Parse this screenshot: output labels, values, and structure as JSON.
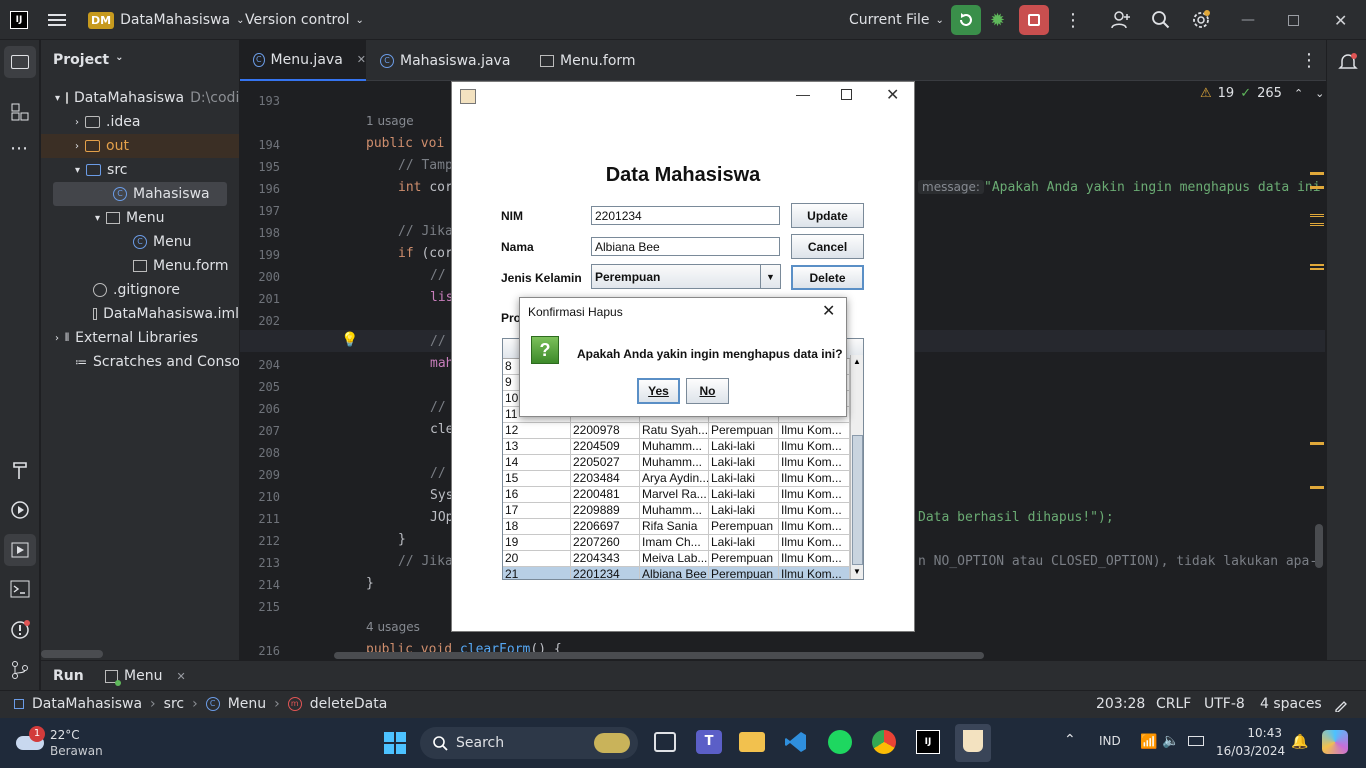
{
  "titlebar": {
    "app_badge": "DM",
    "project_name": "DataMahasiswa",
    "vcs": "Version control",
    "run_config": "Current File"
  },
  "project_panel": {
    "title": "Project",
    "root": "DataMahasiswa",
    "root_path": "D:\\codi",
    "items": [
      {
        "label": ".idea"
      },
      {
        "label": "out"
      },
      {
        "label": "src"
      },
      {
        "label": "Mahasiswa"
      },
      {
        "label": "Menu"
      },
      {
        "label": "Menu"
      },
      {
        "label": "Menu.form"
      },
      {
        "label": ".gitignore"
      },
      {
        "label": "DataMahasiswa.iml"
      },
      {
        "label": "External Libraries"
      },
      {
        "label": "Scratches and Consoles"
      }
    ]
  },
  "tabs": [
    {
      "label": "Menu.java"
    },
    {
      "label": "Mahasiswa.java"
    },
    {
      "label": "Menu.form"
    }
  ],
  "inspections": {
    "warnings": "19",
    "ok": "265"
  },
  "editor": {
    "usage1": "1 usage",
    "usage2": "4 usages",
    "lines": [
      "193",
      "194",
      "195",
      "196",
      "197",
      "198",
      "199",
      "200",
      "201",
      "202",
      "203",
      "204",
      "205",
      "206",
      "207",
      "208",
      "209",
      "210",
      "211",
      "212",
      "213",
      "214",
      "215",
      "216"
    ],
    "code": {
      "l194a": "public ",
      "l194b": "voi",
      "l195": "// Tamp",
      "l196a": "int ",
      "l196b": "cor",
      "l196hint": "message:",
      "l196str": "\"Apakah Anda yakin ingin menghapus data ini",
      "l198": "// Jika",
      "l199a": "if ",
      "l199b": "(cor",
      "l200": "//",
      "l201": "lis",
      "l203": "//",
      "l204": "mah",
      "l206": "//",
      "l207": "cle",
      "l209": "//",
      "l210": "Sys",
      "l211a": "JOp",
      "l211b": "Data berhasil dihapus!\");",
      "l212": "}",
      "l213a": "// Jika",
      "l213b": "n NO_OPTION atau CLOSED_OPTION), tidak lakukan apa-",
      "l214": "}",
      "l216a": "public void ",
      "l216b": "clearForm",
      "l216c": "() {"
    }
  },
  "swing": {
    "heading": "Data Mahasiswa",
    "nim_label": "NIM",
    "nim_value": "2201234",
    "nama_label": "Nama",
    "nama_value": "Albiana Bee",
    "jk_label": "Jenis Kelamin",
    "jk_value": "Perempuan",
    "update_label": "Update",
    "cancel_label": "Cancel",
    "delete_label": "Delete",
    "prodi_label": "Pro",
    "rows": [
      {
        "no": "8",
        "nim": "",
        "nama": "",
        "jk": "",
        "prodi": ""
      },
      {
        "no": "9",
        "nim": "",
        "nama": "",
        "jk": "",
        "prodi": ""
      },
      {
        "no": "10",
        "nim": "",
        "nama": "",
        "jk": "",
        "prodi": ""
      },
      {
        "no": "11",
        "nim": "",
        "nama": "",
        "jk": "",
        "prodi": ""
      },
      {
        "no": "12",
        "nim": "2200978",
        "nama": "Ratu Syah...",
        "jk": "Perempuan",
        "prodi": "Ilmu Kom..."
      },
      {
        "no": "13",
        "nim": "2204509",
        "nama": "Muhamm...",
        "jk": "Laki-laki",
        "prodi": "Ilmu Kom..."
      },
      {
        "no": "14",
        "nim": "2205027",
        "nama": "Muhamm...",
        "jk": "Laki-laki",
        "prodi": "Ilmu Kom..."
      },
      {
        "no": "15",
        "nim": "2203484",
        "nama": "Arya Aydin...",
        "jk": "Laki-laki",
        "prodi": "Ilmu Kom..."
      },
      {
        "no": "16",
        "nim": "2200481",
        "nama": "Marvel Ra...",
        "jk": "Laki-laki",
        "prodi": "Ilmu Kom..."
      },
      {
        "no": "17",
        "nim": "2209889",
        "nama": "Muhamm...",
        "jk": "Laki-laki",
        "prodi": "Ilmu Kom..."
      },
      {
        "no": "18",
        "nim": "2206697",
        "nama": "Rifa Sania",
        "jk": "Perempuan",
        "prodi": "Ilmu Kom..."
      },
      {
        "no": "19",
        "nim": "2207260",
        "nama": "Imam Ch...",
        "jk": "Laki-laki",
        "prodi": "Ilmu Kom..."
      },
      {
        "no": "20",
        "nim": "2204343",
        "nama": "Meiva Lab...",
        "jk": "Perempuan",
        "prodi": "Ilmu Kom..."
      },
      {
        "no": "21",
        "nim": "2201234",
        "nama": "Albiana Bee",
        "jk": "Perempuan",
        "prodi": "Ilmu Kom..."
      }
    ]
  },
  "dialog": {
    "title": "Konfirmasi Hapus",
    "message": "Apakah Anda yakin ingin menghapus data ini?",
    "yes": "Yes",
    "no": "No"
  },
  "runbar": {
    "run": "Run",
    "config": "Menu"
  },
  "statusbar": {
    "crumb1": "DataMahasiswa",
    "crumb2": "src",
    "crumb3": "Menu",
    "crumb4": "deleteData",
    "position": "203:28",
    "line_sep": "CRLF",
    "encoding": "UTF-8",
    "indent": "4 spaces"
  },
  "taskbar": {
    "temp": "22°C",
    "weather": "Berawan",
    "weather_badge": "1",
    "search": "Search",
    "lang": "IND",
    "time": "10:43",
    "date": "16/03/2024"
  }
}
